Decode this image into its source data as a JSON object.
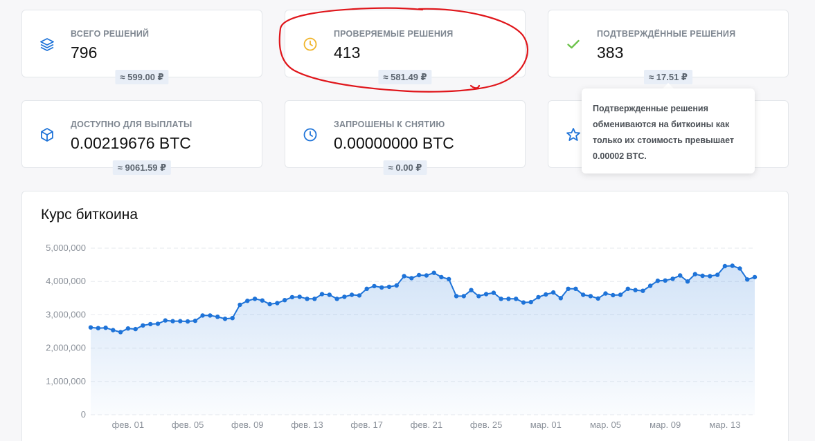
{
  "cards": [
    {
      "label": "Всего решений",
      "value": "796",
      "pill": "≈ 599.00 ₽",
      "icon": "layers-icon"
    },
    {
      "label": "Проверяемые решения",
      "value": "413",
      "pill": "≈ 581.49 ₽",
      "icon": "clock-icon"
    },
    {
      "label": "Подтверждённые решения",
      "value": "383",
      "pill": "≈ 17.51 ₽",
      "icon": "check-icon"
    },
    {
      "label": "Доступно для выплаты",
      "value": "0.00219676 BTC",
      "pill": "≈ 9061.59 ₽",
      "icon": "cube-icon"
    },
    {
      "label": "Запрошены к снятию",
      "value": "0.00000000 BTC",
      "pill": "≈ 0.00 ₽",
      "icon": "clock-icon"
    },
    {
      "icon": "star-icon"
    }
  ],
  "tooltip": {
    "text": "Подтвержденные решения обмениваются на биткоины как только их стоимость превышает 0.00002 BTC."
  },
  "colors": {
    "accent": "#1e73d8",
    "pending": "#f0b429",
    "confirmed": "#6cc24a",
    "annotation": "#e0161b"
  },
  "chart_data": {
    "type": "area",
    "title": "Курс биткоина",
    "ylim": [
      0,
      5000000
    ],
    "yticks": [
      {
        "value": 0,
        "label": "0"
      },
      {
        "value": 1000000,
        "label": "1,000,000"
      },
      {
        "value": 2000000,
        "label": "2,000,000"
      },
      {
        "value": 3000000,
        "label": "3,000,000"
      },
      {
        "value": 4000000,
        "label": "4,000,000"
      },
      {
        "value": 5000000,
        "label": "5,000,000"
      }
    ],
    "xticks": [
      {
        "index": 5,
        "label": "фев. 01"
      },
      {
        "index": 13,
        "label": "фев. 05"
      },
      {
        "index": 21,
        "label": "фев. 09"
      },
      {
        "index": 29,
        "label": "фев. 13"
      },
      {
        "index": 37,
        "label": "фев. 17"
      },
      {
        "index": 45,
        "label": "фев. 21"
      },
      {
        "index": 53,
        "label": "фев. 25"
      },
      {
        "index": 61,
        "label": "мар. 01"
      },
      {
        "index": 69,
        "label": "мар. 05"
      },
      {
        "index": 77,
        "label": "мар. 09"
      },
      {
        "index": 85,
        "label": "мар. 13"
      }
    ],
    "values": [
      2620000,
      2600000,
      2610000,
      2540000,
      2480000,
      2590000,
      2570000,
      2680000,
      2720000,
      2730000,
      2830000,
      2810000,
      2810000,
      2800000,
      2820000,
      2980000,
      2980000,
      2940000,
      2880000,
      2900000,
      3300000,
      3420000,
      3480000,
      3430000,
      3320000,
      3350000,
      3440000,
      3530000,
      3540000,
      3480000,
      3480000,
      3620000,
      3600000,
      3480000,
      3540000,
      3600000,
      3580000,
      3780000,
      3860000,
      3820000,
      3840000,
      3880000,
      4160000,
      4100000,
      4190000,
      4180000,
      4260000,
      4130000,
      4070000,
      3560000,
      3560000,
      3740000,
      3560000,
      3620000,
      3660000,
      3480000,
      3480000,
      3480000,
      3370000,
      3380000,
      3530000,
      3610000,
      3670000,
      3500000,
      3780000,
      3780000,
      3600000,
      3560000,
      3490000,
      3640000,
      3590000,
      3600000,
      3780000,
      3740000,
      3720000,
      3870000,
      4020000,
      4030000,
      4080000,
      4180000,
      4000000,
      4220000,
      4170000,
      4160000,
      4200000,
      4460000,
      4470000,
      4390000,
      4060000,
      4130000
    ]
  }
}
